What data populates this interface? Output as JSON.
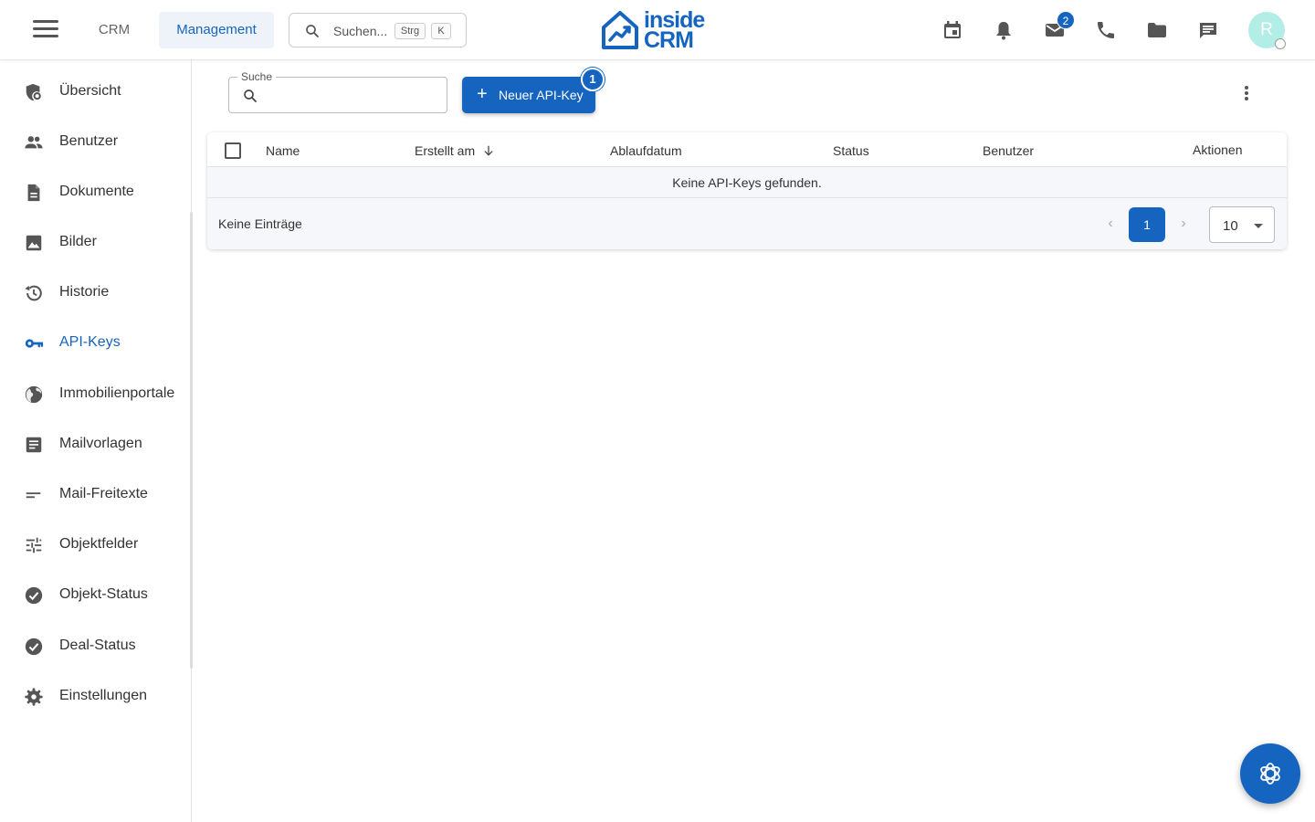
{
  "header": {
    "nav": {
      "crm": "CRM",
      "management": "Management"
    },
    "search": {
      "placeholder": "Suchen...",
      "kbd1": "Strg",
      "kbd2": "K"
    },
    "logo": {
      "line1": "inside",
      "line2": "CRM"
    },
    "icons": [
      "calendar-icon",
      "bell-icon",
      "mail-icon",
      "phone-icon",
      "folder-icon",
      "chat-icon"
    ],
    "mail_badge": "2",
    "avatar": "R",
    "brand_color": "#1565c0"
  },
  "sidebar": {
    "items": [
      {
        "label": "Übersicht",
        "icon": "shield-icon"
      },
      {
        "label": "Benutzer",
        "icon": "users-icon"
      },
      {
        "label": "Dokumente",
        "icon": "document-icon"
      },
      {
        "label": "Bilder",
        "icon": "image-icon"
      },
      {
        "label": "Historie",
        "icon": "history-icon"
      },
      {
        "label": "API-Keys",
        "icon": "key-icon",
        "active": true
      },
      {
        "label": "Immobilienportale",
        "icon": "globe-icon"
      },
      {
        "label": "Mailvorlagen",
        "icon": "template-icon"
      },
      {
        "label": "Mail-Freitexte",
        "icon": "short-text-icon"
      },
      {
        "label": "Objektfelder",
        "icon": "sliders-icon"
      },
      {
        "label": "Objekt-Status",
        "icon": "check-circle-icon"
      },
      {
        "label": "Deal-Status",
        "icon": "check-circle-icon"
      },
      {
        "label": "Einstellungen",
        "icon": "gear-icon"
      }
    ]
  },
  "content": {
    "search_label": "Suche",
    "search_value": "",
    "new_button": "Neuer API-Key",
    "new_badge": "1",
    "table": {
      "columns": [
        "Name",
        "Erstellt am",
        "Ablaufdatum",
        "Status",
        "Benutzer",
        "Aktionen"
      ],
      "sorted_column": "Erstellt am",
      "empty_message": "Keine API-Keys gefunden.",
      "footer_text": "Keine Einträge",
      "current_page": "1",
      "page_size": "10"
    }
  }
}
